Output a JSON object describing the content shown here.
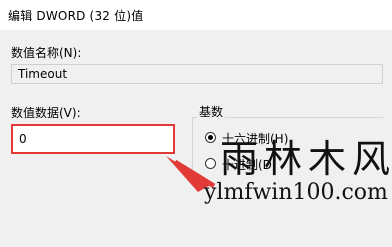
{
  "window": {
    "title": "编辑 DWORD (32 位)值"
  },
  "value_name": {
    "label": "数值名称(N):",
    "value": "Timeout"
  },
  "value_data": {
    "label": "数值数据(V):",
    "value": "0"
  },
  "base": {
    "label": "基数",
    "options": [
      {
        "label": "十六进制(H)",
        "selected": true
      },
      {
        "label": "十进制(D)",
        "selected": false
      }
    ]
  },
  "watermark": {
    "logo": "雨林木风",
    "url": "ylmfwin100.com"
  },
  "colors": {
    "highlight": "#e23b37"
  }
}
